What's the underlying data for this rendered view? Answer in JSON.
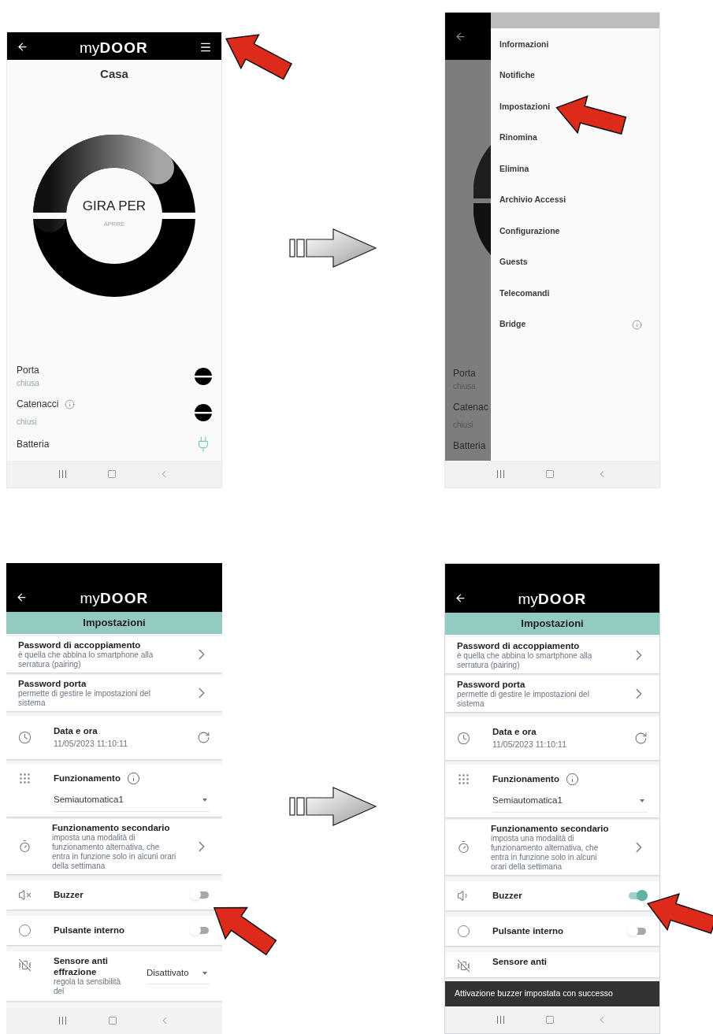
{
  "screens": [
    {
      "kind": "home",
      "header": {
        "logo_prefix": "my",
        "logo_name": "DOOR",
        "menu_button": true
      },
      "title": "Casa",
      "dial": {
        "label": "GIRA PER",
        "sublabel": "APRIRE"
      },
      "status": [
        {
          "label": "Porta",
          "value": "chiusa",
          "info": false,
          "kind": "lock"
        },
        {
          "label": "Catenacci",
          "value": "chiusi",
          "info": true,
          "kind": "lock"
        },
        {
          "label": "Batteria",
          "info": false,
          "kind": "plug"
        }
      ]
    },
    {
      "kind": "menu",
      "background_status": [
        {
          "label": "Porta",
          "value": "chiusa"
        },
        {
          "label": "Catenac",
          "value": "chiusi"
        },
        {
          "label": "Batteria"
        }
      ],
      "menu": [
        {
          "label": "Informazioni",
          "info": false
        },
        {
          "label": "Notifiche",
          "info": false
        },
        {
          "label": "Impostazioni",
          "info": false
        },
        {
          "label": "Rinomina",
          "info": false
        },
        {
          "label": "Elimina",
          "info": false
        },
        {
          "label": "Archivio Accessi",
          "info": false
        },
        {
          "label": "Configurazione",
          "info": false
        },
        {
          "label": "Guests",
          "info": false
        },
        {
          "label": "Telecomandi",
          "info": false
        },
        {
          "label": "Bridge",
          "info": true
        }
      ]
    },
    {
      "kind": "settings",
      "header": {
        "logo_prefix": "my",
        "logo_name": "DOOR",
        "menu_button": false
      },
      "title": "Impostazioni",
      "items": [
        {
          "kind": "link",
          "title": "Password di accoppiamento",
          "description": "è quella che abbina lo smartphone alla serratura (pairing)"
        },
        {
          "kind": "link",
          "title": "Password porta",
          "description": "permette di gestire le impostazioni del sistema"
        },
        {
          "kind": "datetime",
          "title": "Data e ora",
          "value": "11/05/2023 11:10:11"
        },
        {
          "kind": "select",
          "title": "Funzionamento",
          "info": true,
          "value": "Semiautomatica1"
        },
        {
          "kind": "schedule",
          "title": "Funzionamento secondario",
          "description": "imposta una modalità di funzionamento alternativa, che entra in funzione solo in alcuni orari della settimana"
        },
        {
          "kind": "buzzer",
          "title": "Buzzer",
          "on": false
        },
        {
          "kind": "switch",
          "title": "Pulsante interno",
          "on": false
        },
        {
          "kind": "sensor",
          "title": "Sensore anti effrazione",
          "description": "regola la sensibilità del",
          "value": "Disattivato"
        }
      ]
    },
    {
      "kind": "settings",
      "header": {
        "logo_prefix": "my",
        "logo_name": "DOOR",
        "menu_button": false
      },
      "title": "Impostazioni",
      "items": [
        {
          "kind": "link",
          "title": "Password di accoppiamento",
          "description": "è quella che abbina lo smartphone alla serratura (pairing)"
        },
        {
          "kind": "link",
          "title": "Password porta",
          "description": "permette di gestire le impostazioni del sistema"
        },
        {
          "kind": "datetime",
          "title": "Data e ora",
          "value": "11/05/2023 11:10:11"
        },
        {
          "kind": "select",
          "title": "Funzionamento",
          "info": true,
          "value": "Semiautomatica1"
        },
        {
          "kind": "schedule",
          "title": "Funzionamento secondario",
          "description": "imposta una modalità di funzionamento alternativa, che entra in funzione solo in alcuni orari della settimana"
        },
        {
          "kind": "buzzer",
          "title": "Buzzer",
          "on": true
        },
        {
          "kind": "switch",
          "title": "Pulsante interno",
          "on": false
        },
        {
          "kind": "sensor",
          "title": "Sensore anti"
        }
      ],
      "snackbar": "Attivazione buzzer impostata con successo"
    }
  ]
}
